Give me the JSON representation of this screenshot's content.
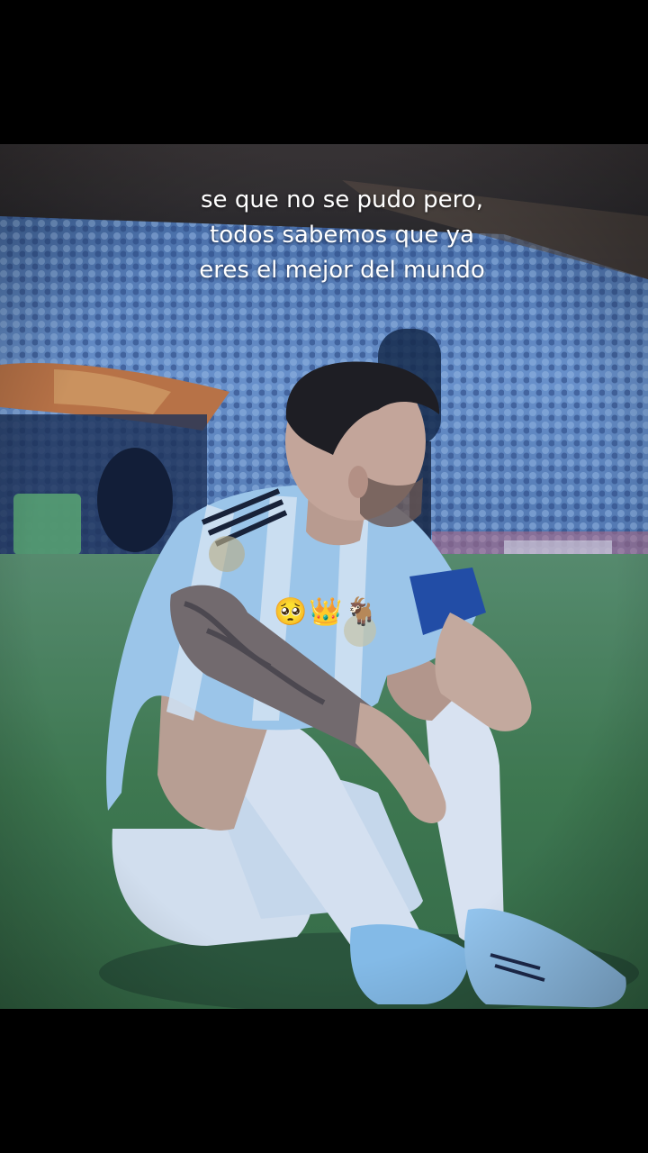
{
  "caption": {
    "line1": "se que no se pudo pero,",
    "line2": "todos sabemos que ya",
    "line3": "eres el mejor del mundo"
  },
  "emoji_sticker": {
    "text": "🥺👑🐐"
  },
  "colors": {
    "letterbox": "#000000",
    "grass": "#3d7a40",
    "crowd": "#5d88c6",
    "jersey_blue": "#7fb8ea",
    "caption_text": "#ffffff"
  }
}
